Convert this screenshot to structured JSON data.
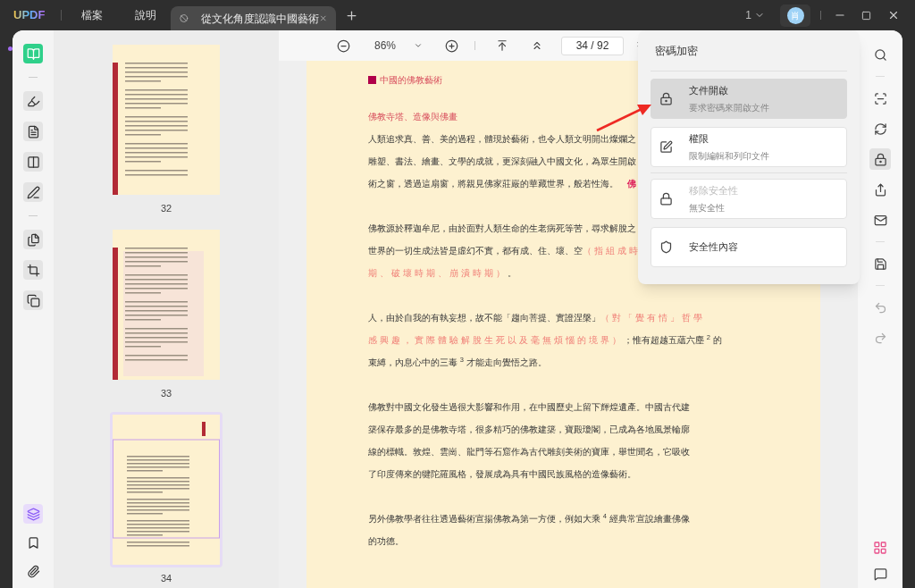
{
  "app": {
    "logo": "UPDF",
    "menu": [
      "檔案",
      "說明"
    ]
  },
  "tabs": [
    {
      "title": "從文化角度認識中國藝術",
      "selected": true
    }
  ],
  "titlebar": {
    "page_count": "1",
    "avatar": "肖"
  },
  "left_tools": [
    {
      "kind": "reader",
      "selected": true
    },
    {
      "kind": "highlight",
      "selected": false
    },
    {
      "kind": "edit",
      "selected": false
    },
    {
      "kind": "form",
      "selected": false
    },
    {
      "kind": "sign",
      "selected": false
    },
    {
      "kind": "pages",
      "selected": false
    },
    {
      "kind": "crop",
      "selected": false
    },
    {
      "kind": "copy",
      "selected": false
    }
  ],
  "left_bottom": [
    {
      "kind": "layers",
      "selected": true
    },
    {
      "kind": "bookmark",
      "selected": false
    },
    {
      "kind": "attach",
      "selected": false
    }
  ],
  "thumbnails": [
    {
      "label": "32",
      "selected": false
    },
    {
      "label": "33",
      "selected": false
    },
    {
      "label": "34",
      "selected": true
    }
  ],
  "toolbar": {
    "zoom": "86%",
    "page_field": "34 / 92"
  },
  "document": {
    "section_title": "中國的佛教藝術",
    "paragraphs": [
      {
        "lines": [
          [
            {
              "text": "佛教寺塔、造像與佛畫",
              "kind": "heading"
            }
          ],
          [
            {
              "text": "人類追求真、善、美的過程，體現於藝術，也令人類文明開出燦爛之",
              "kind": "body"
            }
          ],
          [
            {
              "text": "雕塑、書法、繪畫、文學的成就，更深刻融入中國文化，為眾生開啟",
              "kind": "body"
            }
          ],
          [
            {
              "text": "術之窗，透過這扇窗，將親見佛家莊嚴的華藏世界，般若性海。",
              "kind": "body"
            },
            {
              "text": "佛",
              "kind": "mark"
            }
          ]
        ]
      },
      {
        "lines": [
          [
            {
              "text": "佛教源於釋迦牟尼，由於面對人類生命的生老病死等苦，尋求解脫之",
              "kind": "body"
            }
          ],
          [
            {
              "text": "世界的一切生成法皆是虛幻不實，都有成、住、壞、空",
              "kind": "body"
            },
            {
              "text": "（指組成時",
              "kind": "note"
            }
          ],
          [
            {
              "text": "期、破壞時期、崩潰時期）",
              "kind": "note"
            },
            {
              "text": "。",
              "kind": "body"
            }
          ]
        ]
      },
      {
        "lines": [
          [
            {
              "text": "人，由於自我的有執妄想，故不能「趨向菩提、實證涅槃」",
              "kind": "body"
            },
            {
              "text": "（對「覺有情」哲學",
              "kind": "note"
            }
          ],
          [
            {
              "text": "感興趣，實際體驗解脫生死以及毫無煩惱的境界）",
              "kind": "note"
            },
            {
              "text": "；惟有超越五蘊六塵 $^{2}$ 的",
              "kind": "body"
            }
          ],
          [
            {
              "text": "束縛，內息心中的三毒 $^{3}$ 才能走向覺悟之路。",
              "kind": "body"
            }
          ]
        ]
      },
      {
        "lines": [
          [
            {
              "text": "佛教對中國文化發生過很大影響和作用，在中國歷史上留下輝煌遺產。中國古代建",
              "kind": "body"
            }
          ],
          [
            {
              "text": "築保存最多的是佛教寺塔，很多精巧的佛教建築，寶殿瓊閣，已成為各地風景輪廓",
              "kind": "body"
            }
          ],
          [
            {
              "text": "線的標幟。敦煌、雲崗、龍門等石窟作為古代雕刻美術的寶庫，舉世聞名，它吸收",
              "kind": "body"
            }
          ],
          [
            {
              "text": "了印度傳來的犍陀羅風格，發展成為具有中國民族風格的造像藝術。",
              "kind": "body"
            }
          ]
        ]
      },
      {
        "lines": [
          [
            {
              "text": "另外佛教學者往往透過藝術宣揚佛教為第一方便，例如大乘 $^{4}$ 經典常宣說繪畫佛像",
              "kind": "body"
            }
          ],
          [
            {
              "text": "的功德。",
              "kind": "body"
            }
          ]
        ]
      }
    ]
  },
  "right_tools": [
    {
      "kind": "search",
      "selected": false
    },
    {
      "kind": "ocr",
      "selected": false
    },
    {
      "kind": "convert",
      "selected": false
    },
    {
      "kind": "protect",
      "selected": true
    },
    {
      "kind": "share",
      "selected": false
    },
    {
      "kind": "mail",
      "selected": false
    },
    {
      "kind": "save",
      "selected": false
    },
    {
      "kind": "undo",
      "selected": false
    },
    {
      "kind": "redo",
      "selected": false
    }
  ],
  "security_menu": {
    "title": "密碼加密",
    "items": [
      {
        "kind": "open",
        "title": "文件開啟",
        "subtitle": "要求密碼來開啟文件",
        "selected": true,
        "disabled": false
      },
      {
        "kind": "permissions",
        "title": "權限",
        "subtitle": "限制編輯和列印文件",
        "selected": false,
        "disabled": false
      },
      {
        "kind": "remove",
        "title": "移除安全性",
        "subtitle": "無安全性",
        "selected": false,
        "disabled": true
      },
      {
        "kind": "properties",
        "title": "安全性內容",
        "selected": false,
        "disabled": false
      }
    ]
  }
}
